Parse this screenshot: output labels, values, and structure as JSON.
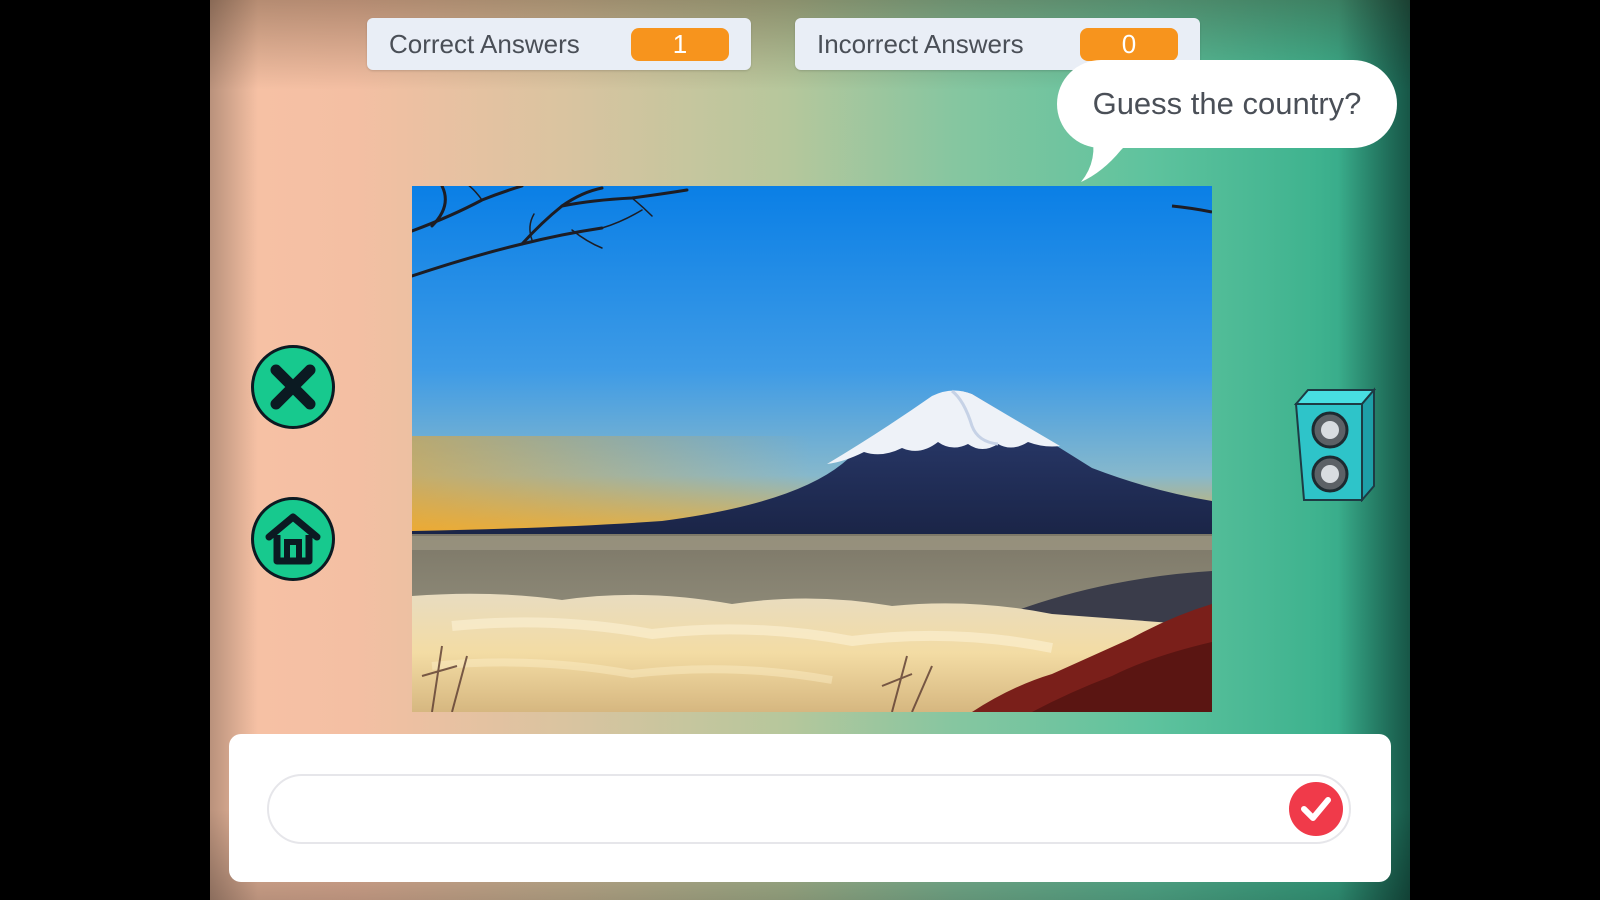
{
  "scoreboard": {
    "correct_label": "Correct Answers",
    "correct_value": "1",
    "incorrect_label": "Incorrect Answers",
    "incorrect_value": "0"
  },
  "prompt": {
    "text": "Guess the country?"
  },
  "photo": {
    "subject": "snow-capped mountain above a sea of clouds at sunrise"
  },
  "controls": {
    "close_icon": "close-x-icon",
    "home_icon": "home-icon",
    "speaker_icon": "speaker-icon",
    "submit_icon": "checkmark-icon"
  },
  "answer": {
    "value": "",
    "placeholder": ""
  },
  "colors": {
    "accent_green": "#17c98e",
    "counter_orange": "#f7941d",
    "submit_red": "#f03a4a",
    "speaker_teal": "#2ec4c9"
  }
}
